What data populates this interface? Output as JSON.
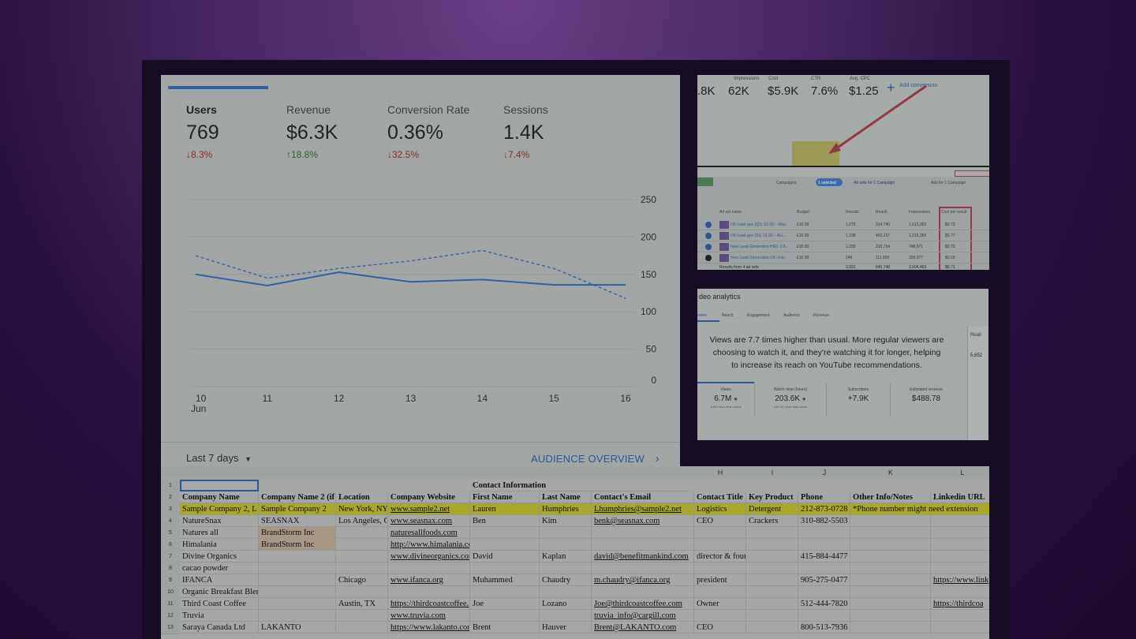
{
  "analytics": {
    "metrics": [
      {
        "label": "Users",
        "value": "769",
        "change": "8.3%",
        "dir": "down"
      },
      {
        "label": "Revenue",
        "value": "$6.3K",
        "change": "18.8%",
        "dir": "up"
      },
      {
        "label": "Conversion Rate",
        "value": "0.36%",
        "change": "32.5%",
        "dir": "down"
      },
      {
        "label": "Sessions",
        "value": "1.4K",
        "change": "7.4%",
        "dir": "down"
      }
    ],
    "date_range": "Last 7 days",
    "overview_link": "AUDIENCE OVERVIEW",
    "month_label": "Jun"
  },
  "chart_data": {
    "type": "line",
    "x": [
      10,
      11,
      12,
      13,
      14,
      15,
      16
    ],
    "ylim": [
      0,
      250
    ],
    "yticks": [
      0,
      50,
      100,
      150,
      200,
      250
    ],
    "series": [
      {
        "values": [
          150,
          135,
          153,
          140,
          143,
          136,
          136
        ],
        "style": "solid"
      },
      {
        "values": [
          175,
          145,
          158,
          168,
          182,
          158,
          118
        ],
        "style": "dashed"
      }
    ],
    "colors": {
      "line": "#2f5fa8"
    }
  },
  "ads": {
    "stats": [
      {
        "k": "",
        "v": ".8K"
      },
      {
        "k": "Impressions",
        "v": "62K"
      },
      {
        "k": "Cost",
        "v": "$5.9K"
      },
      {
        "k": "CTR",
        "v": "7.6%"
      },
      {
        "k": "Avg. CPC",
        "v": "$1.25"
      }
    ],
    "add_label": "Add conversion",
    "tabs": [
      "Campaigns",
      "Ad sets for 1 Campaign",
      "Ads for 1 Campaign"
    ],
    "selected": "1 selected",
    "col_headers": [
      "Ad set name",
      "Budget",
      "Results",
      "Reach",
      "Impressions",
      "Cost per result"
    ],
    "rows": [
      {
        "name": "UK Lead gen (Q1) 12-30 – Mas..",
        "budget": "£15.00",
        "results": "1,075",
        "reach": "314,740",
        "impr": "1,015,353",
        "cpr": "$0.73"
      },
      {
        "name": "UK Lead gen (01) 12-30 – ALL..",
        "budget": "£15.00",
        "results": "1,338",
        "reach": "403,237",
        "impr": "1,016,350",
        "cpr": "$0.77"
      },
      {
        "name": "New Lead Generation HIEL 2-9..",
        "budget": "£15.00",
        "results": "1,255",
        "reach": "315,734",
        "impr": "748,971",
        "cpr": "$0.73"
      },
      {
        "name": "New Lead Generation UK Univ..",
        "budget": "£15.00",
        "results": "249",
        "reach": "111,809",
        "impr": "309,377",
        "cpr": "$0.60"
      }
    ],
    "footer": "Results from 4 ad sets",
    "footer_vals": {
      "results": "3,921",
      "reach": "645,748",
      "impr": "3,004,453",
      "cpr": "$0.71"
    }
  },
  "video": {
    "title": "deo analytics",
    "tabs": [
      "rview",
      "Reach",
      "Engagement",
      "Audience",
      "Revenue"
    ],
    "message": "Views are 7.7 times higher than usual. More regular viewers are choosing to watch it, and they're watching it for longer, helping to increase its reach on YouTube recommendations.",
    "cards": [
      {
        "k": "Views",
        "v": "6.7M",
        "s": "5.8M more than usual"
      },
      {
        "k": "Watch time (hours)",
        "v": "203.6K",
        "s": "120.4K more than usual"
      },
      {
        "k": "Subscribers",
        "v": "+7.9K",
        "s": ""
      },
      {
        "k": "Estimated revenue",
        "v": "$488.78",
        "s": ""
      }
    ],
    "side_value": "5,652",
    "side_label": "Realt"
  },
  "sheet": {
    "col_letters": [
      "",
      "H",
      "I",
      "J",
      "K",
      "L"
    ],
    "group_header": "Contact Information",
    "headers": [
      "Company Name",
      "Company Name 2 (if",
      "Location",
      "Company Website",
      "First Name",
      "Last Name",
      "Contact's Email",
      "Contact Title",
      "Key Product",
      "Phone",
      "Other Info/Notes",
      "Linkedin URL"
    ],
    "rows": [
      [
        "Sample Company 2, L",
        "Sample Company 2",
        "New York, NY",
        "www.sample2.net",
        "Lauren",
        "Humphries",
        "Lhumphries@sample2.net",
        "Logistics",
        "Detergent",
        "212-873-0728",
        "*Phone number might need extension",
        ""
      ],
      [
        "NatureSnax",
        "SEASNAX",
        "Los Angeles, Ca",
        "www.seasnax.com",
        "Ben",
        "Kim",
        "benk@seasnax.com",
        "CEO",
        "Crackers",
        "310-882-5503",
        "",
        ""
      ],
      [
        "Natures all",
        "BrandStorm Inc",
        "",
        "naturesallfoods.com",
        "",
        "",
        "",
        "",
        "",
        "",
        "",
        ""
      ],
      [
        "Himalania",
        "BrandStorm Inc",
        "",
        "http://www.himalania.com/",
        "",
        "",
        "",
        "",
        "",
        "",
        "",
        ""
      ],
      [
        "Divine Organics",
        "",
        "",
        "www.divineorganics.com",
        "David",
        "Kaplan",
        "david@benefitmankind.com",
        "director & founder",
        "",
        "415-884-4477",
        "",
        ""
      ],
      [
        "cacao powder",
        "",
        "",
        "",
        "",
        "",
        "",
        "",
        "",
        "",
        "",
        ""
      ],
      [
        "IFANCA",
        "",
        "Chicago",
        "www.ifanca.org",
        "Muhammed",
        "Chaudry",
        "m.chaudry@ifanca.org",
        "president",
        "",
        "905-275-0477",
        "",
        "https://www.link"
      ],
      [
        "Organic Breakfast Blend",
        "",
        "",
        "",
        "",
        "",
        "",
        "",
        "",
        "",
        "",
        ""
      ],
      [
        "Third Coast Coffee",
        "",
        "Austin, TX",
        "https://thirdcoastcoffee.",
        "Joe",
        "Lozano",
        "Joe@thirdcoastcoffee.com",
        "Owner",
        "",
        "512-444-7820",
        "",
        "https://thirdcoa"
      ],
      [
        "Truvia",
        "",
        "",
        "www.truvia.com",
        "",
        "",
        "truvia_info@cargill.com",
        "",
        "",
        "",
        "",
        ""
      ],
      [
        "Saraya Canada Ltd",
        "LAKANTO",
        "",
        "https://www.lakanto.com",
        "Brent",
        "Hauver",
        "Brent@LAKANTO.com",
        "CEO",
        "",
        "800-513-7936",
        "",
        ""
      ]
    ],
    "row_numbers": [
      "1",
      "2",
      "3",
      "4",
      "5",
      "6",
      "7",
      "8",
      "9",
      "10",
      "11",
      "12",
      "13"
    ]
  }
}
